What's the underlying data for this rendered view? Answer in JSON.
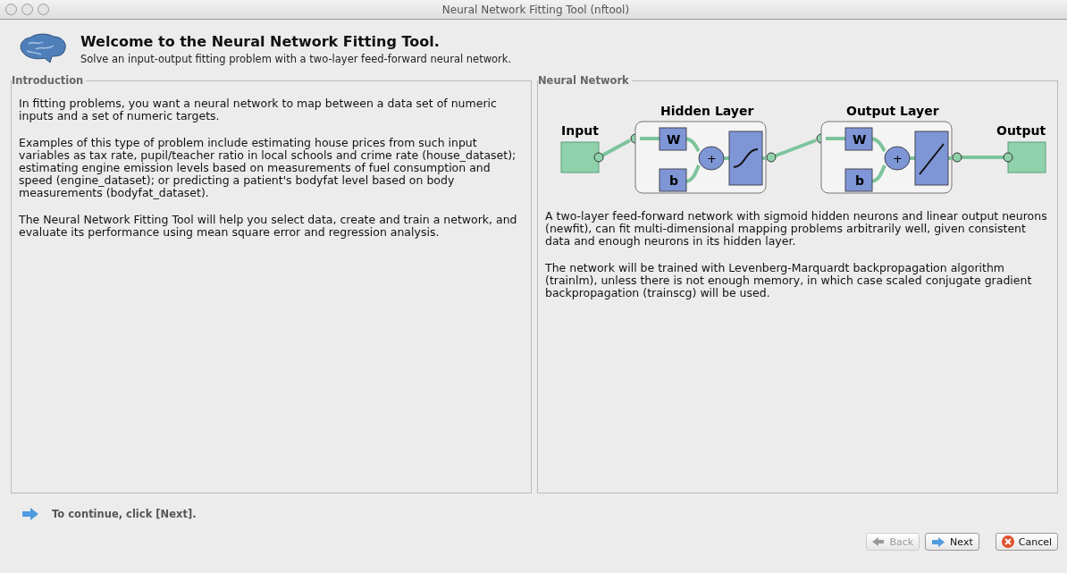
{
  "window": {
    "title": "Neural Network Fitting Tool (nftool)"
  },
  "header": {
    "title": "Welcome to the Neural Network Fitting Tool.",
    "subtitle": "Solve an input-output fitting problem with a two-layer feed-forward neural network."
  },
  "introduction": {
    "title": "Introduction",
    "paragraphs": [
      "In fitting problems, you want a neural network to map between a data set of numeric inputs and a set of numeric targets.",
      "Examples of this type of problem include estimating house prices from such input variables as tax rate, pupil/teacher ratio in local schools and crime rate (house_dataset); estimating engine emission levels based on measurements of fuel consumption and speed (engine_dataset); or predicting a patient's bodyfat level based on body measurements (bodyfat_dataset).",
      "The Neural Network Fitting Tool will help you select data, create and train a network, and evaluate its performance using mean square error and regression analysis."
    ]
  },
  "network": {
    "title": "Neural Network",
    "diagram": {
      "input": "Input",
      "output": "Output",
      "layers": [
        {
          "title": "Hidden Layer",
          "kind": "sigmoid",
          "weight": "W",
          "bias": "b",
          "sum": "+"
        },
        {
          "title": "Output Layer",
          "kind": "linear",
          "weight": "W",
          "bias": "b",
          "sum": "+"
        }
      ]
    },
    "paragraphs": [
      "A two-layer feed-forward network with sigmoid hidden neurons and linear output neurons (newfit), can fit multi-dimensional mapping problems arbitrarily well, given consistent data and enough neurons in its hidden layer.",
      "The network will be trained with Levenberg-Marquardt backpropagation algorithm (trainlm), unless there is not enough memory, in which case scaled conjugate gradient backpropagation (trainscg) will be used."
    ]
  },
  "hint": "To continue, click [Next].",
  "buttons": [
    {
      "label": "Back",
      "kind": "back",
      "disabled": true
    },
    {
      "label": "Next",
      "kind": "next",
      "disabled": false
    },
    {
      "label": "Cancel",
      "kind": "cancel",
      "disabled": false
    }
  ]
}
